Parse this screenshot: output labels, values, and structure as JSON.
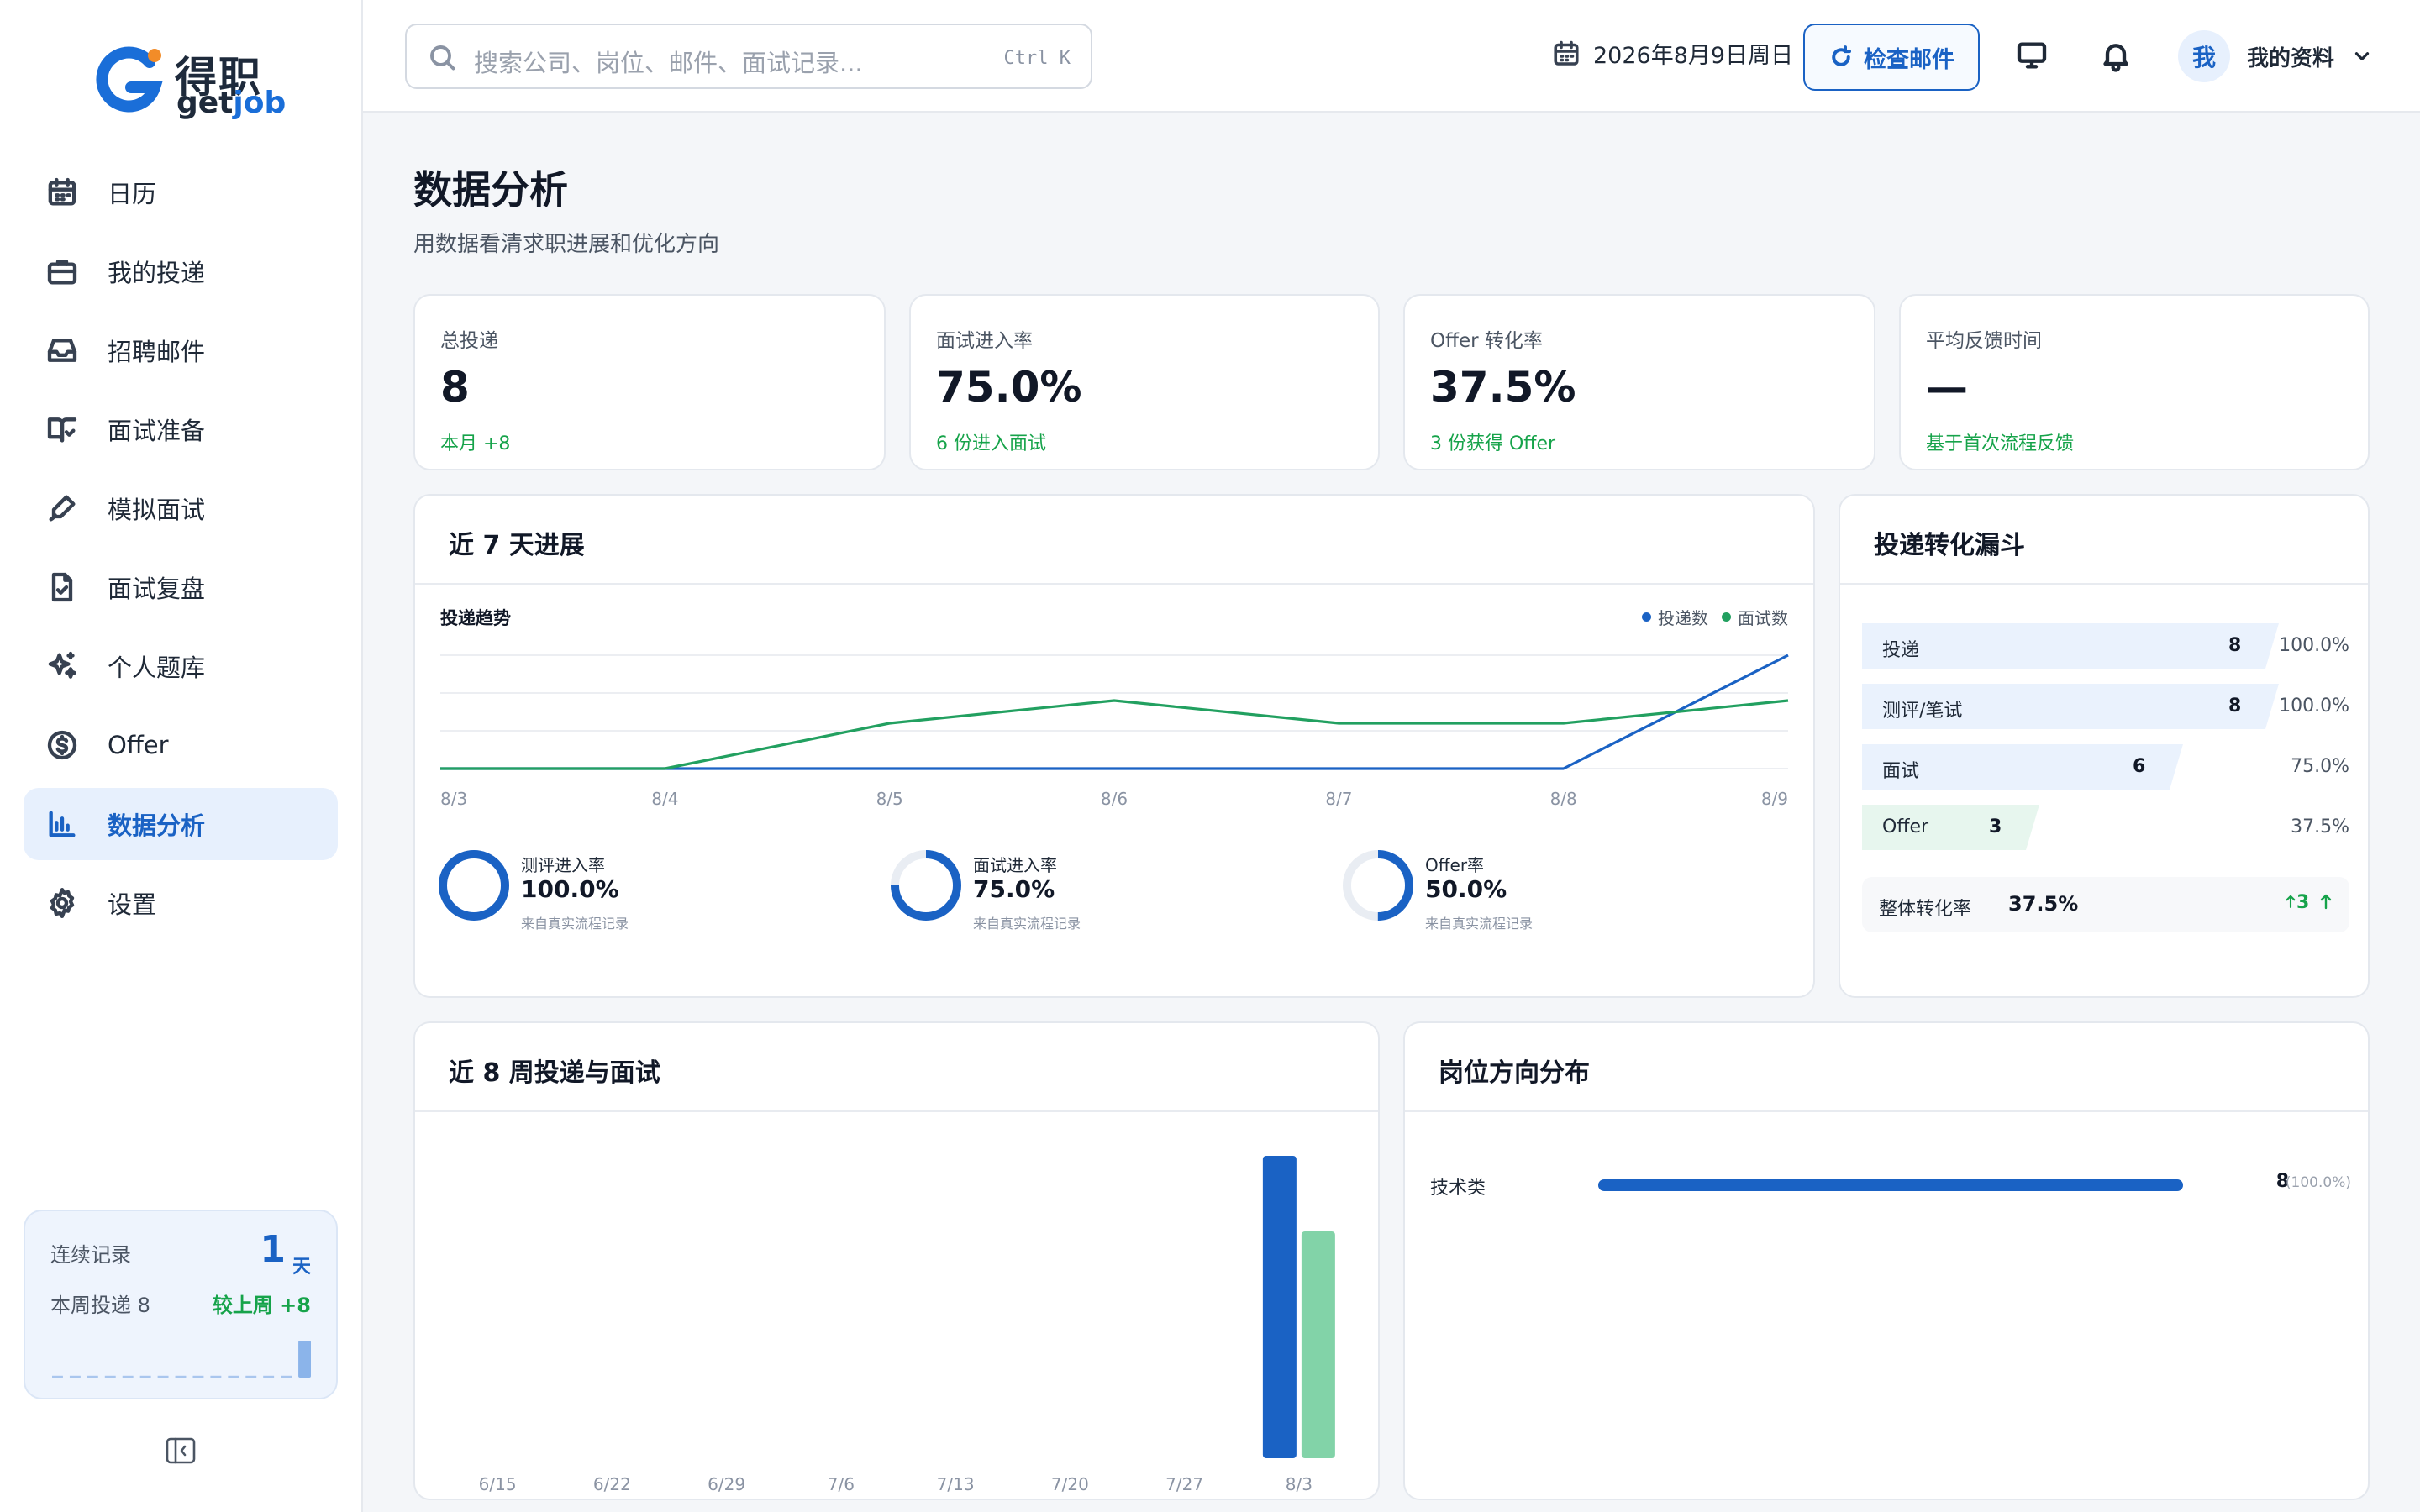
{
  "brand": {
    "name_cn": "得职",
    "name_en_a": "get",
    "name_en_b": "job",
    "accent": "#1a62c4",
    "logo_dot": "#f28c28"
  },
  "sidebar": {
    "items": [
      {
        "label": "日历",
        "icon": "calendar-icon"
      },
      {
        "label": "我的投递",
        "icon": "briefcase-icon"
      },
      {
        "label": "招聘邮件",
        "icon": "inbox-icon"
      },
      {
        "label": "面试准备",
        "icon": "book-open-icon"
      },
      {
        "label": "模拟面试",
        "icon": "pen-icon"
      },
      {
        "label": "面试复盘",
        "icon": "file-check-icon"
      },
      {
        "label": "个人题库",
        "icon": "sparkles-icon"
      },
      {
        "label": "Offer",
        "icon": "dollar-circle-icon"
      },
      {
        "label": "数据分析",
        "icon": "bar-chart-icon",
        "active": true
      },
      {
        "label": "设置",
        "icon": "gear-icon"
      }
    ],
    "streak": {
      "label": "连续记录",
      "days": "1",
      "unit": "天",
      "week_label": "本周投递 8",
      "week_delta": "较上周 +8",
      "spark": [
        0,
        0,
        0,
        0,
        0,
        0,
        0,
        0,
        0,
        0,
        0,
        0,
        0,
        0,
        8
      ]
    }
  },
  "topbar": {
    "search_placeholder": "搜索公司、岗位、邮件、面试记录...",
    "search_shortcut": "Ctrl K",
    "date": "2026年8月9日周日",
    "check_mail_label": "检查邮件",
    "avatar_text": "我",
    "profile_label": "我的资料"
  },
  "page": {
    "title": "数据分析",
    "subtitle": "用数据看清求职进展和优化方向"
  },
  "stats": [
    {
      "label": "总投递",
      "value": "8",
      "note": "本月 +8"
    },
    {
      "label": "面试进入率",
      "value": "75.0%",
      "note": "6 份进入面试"
    },
    {
      "label": "Offer 转化率",
      "value": "37.5%",
      "note": "3 份获得 Offer"
    },
    {
      "label": "平均反馈时间",
      "value": "—",
      "note": "基于首次流程反馈"
    }
  ],
  "trend_card": {
    "title": "近 7 天进展",
    "chart_title": "投递趋势",
    "legend": [
      {
        "name": "投递数",
        "color": "#1a62c4"
      },
      {
        "name": "面试数",
        "color": "#22a060"
      }
    ],
    "rates": [
      {
        "label": "测评进入率",
        "value": "100.0%",
        "fraction": 1.0,
        "note": "来自真实流程记录"
      },
      {
        "label": "面试进入率",
        "value": "75.0%",
        "fraction": 0.75,
        "note": "来自真实流程记录"
      },
      {
        "label": "Offer率",
        "value": "50.0%",
        "fraction": 0.5,
        "note": "来自真实流程记录"
      }
    ]
  },
  "funnel_card": {
    "title": "投递转化漏斗",
    "rows": [
      {
        "label": "投递",
        "count": "8",
        "pct": "100.0%",
        "fraction": 1.0,
        "kind": "blue"
      },
      {
        "label": "测评/笔试",
        "count": "8",
        "pct": "100.0%",
        "fraction": 1.0,
        "kind": "blue"
      },
      {
        "label": "面试",
        "count": "6",
        "pct": "75.0%",
        "fraction": 0.75,
        "kind": "blue"
      },
      {
        "label": "Offer",
        "count": "3",
        "pct": "37.5%",
        "fraction": 0.375,
        "kind": "green"
      }
    ],
    "total_label": "整体转化率",
    "total_value": "37.5%",
    "total_delta": "3"
  },
  "weekly_card": {
    "title": "近 8 周投递与面试"
  },
  "dist_card": {
    "title": "岗位方向分布",
    "rows": [
      {
        "label": "技术类",
        "count": "8",
        "pct": "(100.0%)",
        "fraction": 1.0
      }
    ]
  },
  "chart_data": [
    {
      "type": "line",
      "title": "投递趋势",
      "x": [
        "8/3",
        "8/4",
        "8/5",
        "8/6",
        "8/7",
        "8/8",
        "8/9"
      ],
      "ylim": [
        0,
        10
      ],
      "series": [
        {
          "name": "投递数",
          "color": "#1a62c4",
          "values": [
            0,
            0,
            0,
            0,
            0,
            0,
            10
          ]
        },
        {
          "name": "面试数",
          "color": "#22a060",
          "values": [
            0,
            0,
            4,
            6,
            4,
            4,
            6
          ]
        }
      ]
    },
    {
      "type": "bar",
      "categories": [
        "6/15",
        "6/22",
        "6/29",
        "7/6",
        "7/13",
        "7/20",
        "7/27",
        "8/3"
      ],
      "ylim": [
        0,
        8
      ],
      "series": [
        {
          "name": "",
          "color": "#1a62c4",
          "values": [
            0,
            0,
            0,
            0,
            0,
            0,
            0,
            8
          ]
        },
        {
          "name": "",
          "color": "#82d3a8",
          "values": [
            0,
            0,
            0,
            0,
            0,
            0,
            0,
            6
          ]
        }
      ]
    }
  ]
}
